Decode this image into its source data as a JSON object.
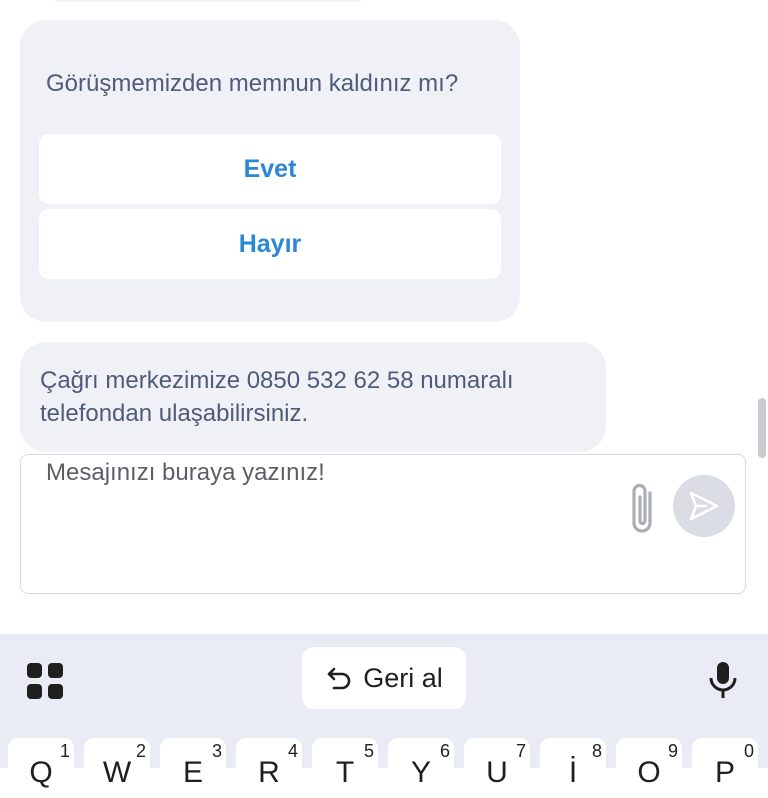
{
  "chat": {
    "survey": {
      "question": "Görüşmemizden memnun kaldınız mı?",
      "yes_label": "Evet",
      "no_label": "Hayır"
    },
    "info_message": "Çağrı merkezimize 0850 532 62 58 numaralı telefondan ulaşabilirsiniz."
  },
  "composer": {
    "placeholder": "Mesajınızı buraya yazınız!",
    "value": ""
  },
  "keyboard": {
    "undo_label": "Geri al",
    "keys": [
      {
        "letter": "Q",
        "hint": "1"
      },
      {
        "letter": "W",
        "hint": "2"
      },
      {
        "letter": "E",
        "hint": "3"
      },
      {
        "letter": "R",
        "hint": "4"
      },
      {
        "letter": "T",
        "hint": "5"
      },
      {
        "letter": "Y",
        "hint": "6"
      },
      {
        "letter": "U",
        "hint": "7"
      },
      {
        "letter": "İ",
        "hint": "8"
      },
      {
        "letter": "O",
        "hint": "9"
      },
      {
        "letter": "P",
        "hint": "0"
      }
    ]
  },
  "icons": {
    "attach": "paperclip-icon",
    "send": "send-icon",
    "apps": "grid-icon",
    "undo": "undo-icon",
    "mic": "microphone-icon"
  },
  "colors": {
    "bubble": "#eff1f6",
    "accent": "#2b86d6",
    "text": "#4f5b78",
    "keyboard_bg": "#e9ecf4"
  }
}
